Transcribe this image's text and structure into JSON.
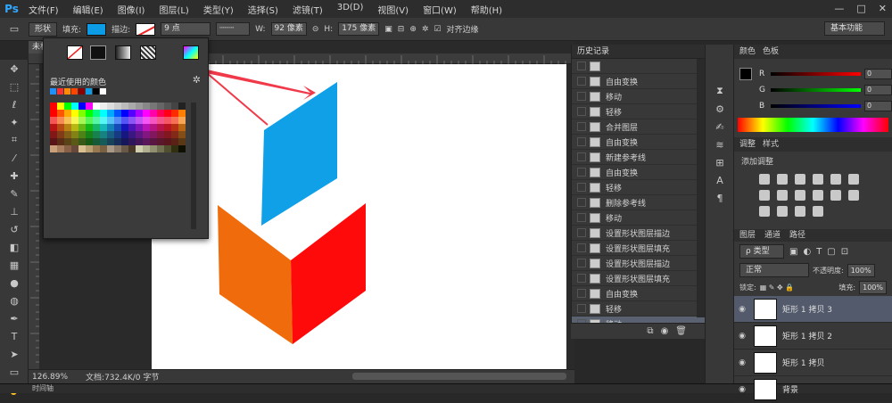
{
  "app": {
    "logo": "Ps"
  },
  "menu": [
    "文件(F)",
    "编辑(E)",
    "图像(I)",
    "图层(L)",
    "类型(Y)",
    "选择(S)",
    "滤镜(T)",
    "3D(D)",
    "视图(V)",
    "窗口(W)",
    "帮助(H)"
  ],
  "window_controls": [
    "—",
    "□",
    "✕"
  ],
  "options": {
    "mode": "形状",
    "fill_label": "填充:",
    "stroke_label": "描边:",
    "stroke_width": "9 点",
    "w_label": "W:",
    "w_value": "92 像素",
    "h_label": "H:",
    "h_value": "175 像素",
    "align_edges": "对齐边缘",
    "workspace": "基本功能",
    "fill_color": "#0d9de7"
  },
  "document": {
    "tab": "未标",
    "zoom": "126.89%",
    "doc_info": "文档:732.4K/0 字节"
  },
  "timeline": "时间轴",
  "popup": {
    "recent_label": "最近使用的颜色"
  },
  "history": {
    "tab": "历史记录",
    "items": [
      "",
      "自由变换",
      "移动",
      "轻移",
      "合并图层",
      "自由变换",
      "新建参考线",
      "自由变换",
      "轻移",
      "删除参考线",
      "移动",
      "设置形状图层描边",
      "设置形状图层填充",
      "设置形状图层描边",
      "设置形状图层填充",
      "自由变换",
      "轻移",
      "移动"
    ],
    "selected_index": 17
  },
  "color_panel": {
    "tabs": [
      "颜色",
      "色板"
    ],
    "sliders": [
      {
        "label": "R",
        "value": "0"
      },
      {
        "label": "G",
        "value": "0"
      },
      {
        "label": "B",
        "value": "0"
      }
    ]
  },
  "adjust_panel": {
    "tabs": [
      "调整",
      "样式"
    ],
    "title": "添加调整"
  },
  "layers_panel": {
    "tabs": [
      "图层",
      "通道",
      "路径"
    ],
    "filter": "ρ 类型",
    "blend_mode": "正常",
    "opacity_label": "不透明度:",
    "opacity": "100%",
    "lock_label": "锁定:",
    "fill_label": "填充:",
    "fill": "100%",
    "layers": [
      {
        "name": "矩形 1 拷贝 3",
        "selected": true
      },
      {
        "name": "矩形 1 拷贝 2",
        "selected": false
      },
      {
        "name": "矩形 1 拷贝",
        "selected": false
      },
      {
        "name": "背景",
        "selected": false
      }
    ]
  },
  "canvas": {
    "top_face": "#10a0e8",
    "left_face": "#ef6b0c",
    "right_face": "#ff0a0a",
    "arrow": "#f03a4a"
  }
}
